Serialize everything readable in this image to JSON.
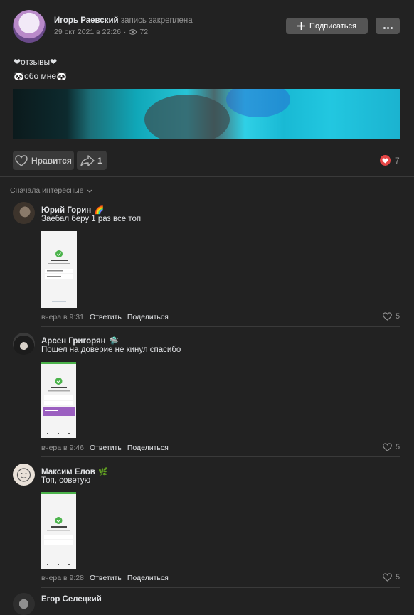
{
  "post": {
    "author": "Игорь Раевский",
    "pinned_label": "запись закреплена",
    "date": "29 окт 2021 в 22:26",
    "views": "72",
    "subscribe_label": "Подписаться",
    "line1": "❤отзывы❤",
    "line2": "🐼обо мне🐼",
    "like_label": "Нравится",
    "share_count": "1",
    "likes_count": "7"
  },
  "sort_label": "Сначала интересные",
  "comments": [
    {
      "author": "Юрий Горин",
      "badge": "🌈",
      "text": "Заебал беру 1 раз все топ",
      "time": "вчера в 9:31",
      "reply": "Ответить",
      "share": "Поделиться",
      "likes": "5"
    },
    {
      "author": "Арсен Григорян",
      "badge": "🛸",
      "text": "Пошел на доверие не кинул спасибо",
      "time": "вчера в 9:46",
      "reply": "Ответить",
      "share": "Поделиться",
      "likes": "5"
    },
    {
      "author": "Максим Елов",
      "badge": "🌿",
      "text": "Топ, советую",
      "time": "вчера в 9:28",
      "reply": "Ответить",
      "share": "Поделиться",
      "likes": "5"
    },
    {
      "author": "Егор Селецкий"
    }
  ],
  "colors": {
    "bg": "#222222",
    "accent_heart": "#e64646",
    "check_green": "#4bb34b",
    "button_bg": "#555555"
  }
}
